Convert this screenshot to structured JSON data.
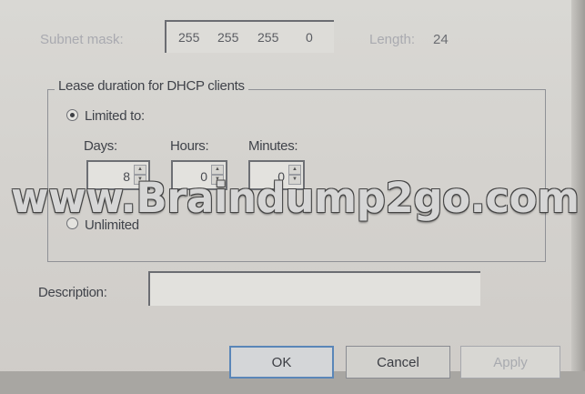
{
  "subnet": {
    "label": "Subnet mask:",
    "octets": [
      "255",
      "255",
      "255",
      "0"
    ],
    "length_label": "Length:",
    "length_value": "24"
  },
  "lease": {
    "group_title": "Lease duration for DHCP clients",
    "limited_label": "Limited to:",
    "limited_selected": true,
    "days_label": "Days:",
    "hours_label": "Hours:",
    "minutes_label": "Minutes:",
    "days_value": "8",
    "hours_value": "0",
    "minutes_value": "0",
    "unlimited_label": "Unlimited"
  },
  "description": {
    "label": "Description:",
    "value": ""
  },
  "buttons": {
    "ok": "OK",
    "cancel": "Cancel",
    "apply": "Apply"
  },
  "watermark": "www.Braindump2go.com"
}
